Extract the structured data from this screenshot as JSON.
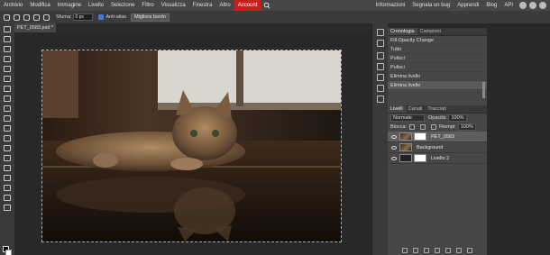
{
  "menu": {
    "items": [
      "Archivio",
      "Modifica",
      "Immagine",
      "Livello",
      "Selezione",
      "Filtro",
      "Visualizza",
      "Finestra",
      "Altro",
      "Account"
    ],
    "right": [
      "Informazioni",
      "Segnala un bug",
      "Apprendi",
      "Blog",
      "API"
    ]
  },
  "options": {
    "sfuma_label": "Sfuma:",
    "sfuma_value": "0 px",
    "antialias_label": "Anti-alias",
    "refine_button": "Migliora bordo"
  },
  "document_tab": "PET_0583.psd *",
  "history_panel": {
    "tabs": [
      "Cronologia",
      "Campioni"
    ],
    "rows": [
      "Fill Opacity Change",
      "Tutto",
      "Pulisci",
      "Pulisci",
      "Elimina livello",
      "Elimina livello"
    ]
  },
  "layers_panel": {
    "tabs": [
      "Livelli",
      "Canali",
      "Tracciati"
    ],
    "blend_mode": "Normale",
    "opacity_label": "Opacità:",
    "opacity_value": "100%",
    "lock_label": "Blocca:",
    "fill_label": "Riempi:",
    "fill_value": "100%",
    "layers": [
      {
        "name": "PET_0583",
        "selected": true
      },
      {
        "name": "Background",
        "selected": false
      },
      {
        "name": "Livello 2",
        "selected": false
      }
    ]
  },
  "colors": {
    "accent": "#c81e1e",
    "selection": "#3b7dd8"
  }
}
